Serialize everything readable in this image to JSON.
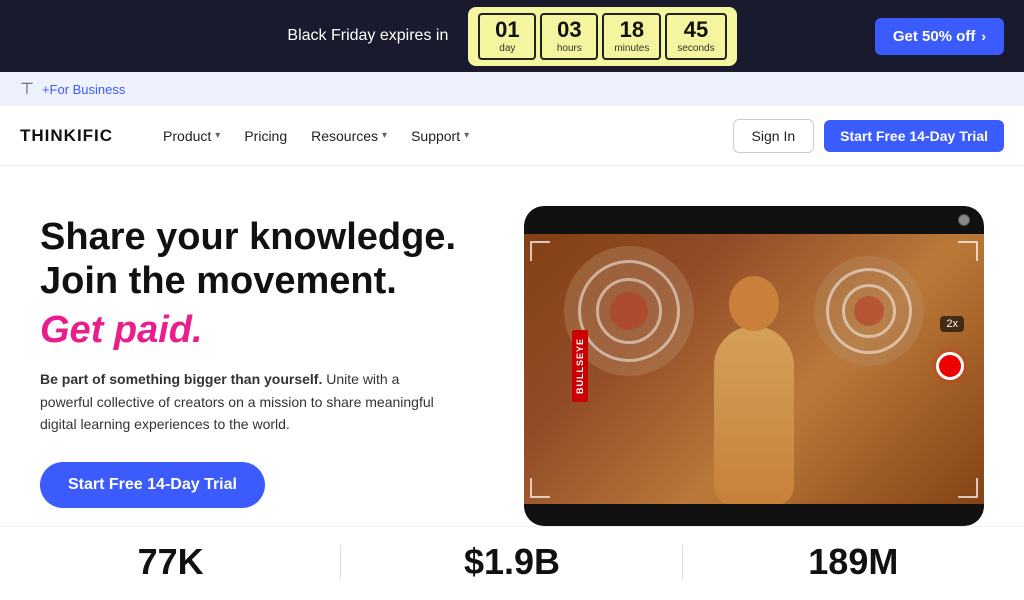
{
  "banner": {
    "text": "Black Friday expires in",
    "timer": {
      "day": {
        "value": "01",
        "label": "day"
      },
      "hours": {
        "value": "03",
        "label": "hours"
      },
      "minutes": {
        "value": "18",
        "label": "minutes"
      },
      "seconds": {
        "value": "45",
        "label": "seconds"
      }
    },
    "cta": "Get 50% off"
  },
  "business_bar": {
    "label": "+For Business"
  },
  "nav": {
    "logo": "THINKIFIC",
    "items": [
      {
        "label": "Product",
        "has_dropdown": true
      },
      {
        "label": "Pricing",
        "has_dropdown": false
      },
      {
        "label": "Resources",
        "has_dropdown": true
      },
      {
        "label": "Support",
        "has_dropdown": true
      }
    ],
    "sign_in": "Sign In",
    "trial_cta": "Start Free 14-Day Trial"
  },
  "hero": {
    "headline_line1": "Share your knowledge.",
    "headline_line2": "Join the movement.",
    "headline_paid": "Get paid.",
    "subtext_bold": "Be part of something bigger than yourself.",
    "subtext": " Unite with a powerful collective of creators on a mission to share meaningful digital learning experiences to the world.",
    "cta": "Start Free 14-Day Trial"
  },
  "stats": [
    {
      "value": "77K"
    },
    {
      "value": "$1.9B"
    },
    {
      "value": "189M"
    }
  ],
  "colors": {
    "blue": "#3b5bfc",
    "pink": "#e91e8c",
    "yellow_bg": "#f5f5a0",
    "dark": "#1a1a2e"
  }
}
